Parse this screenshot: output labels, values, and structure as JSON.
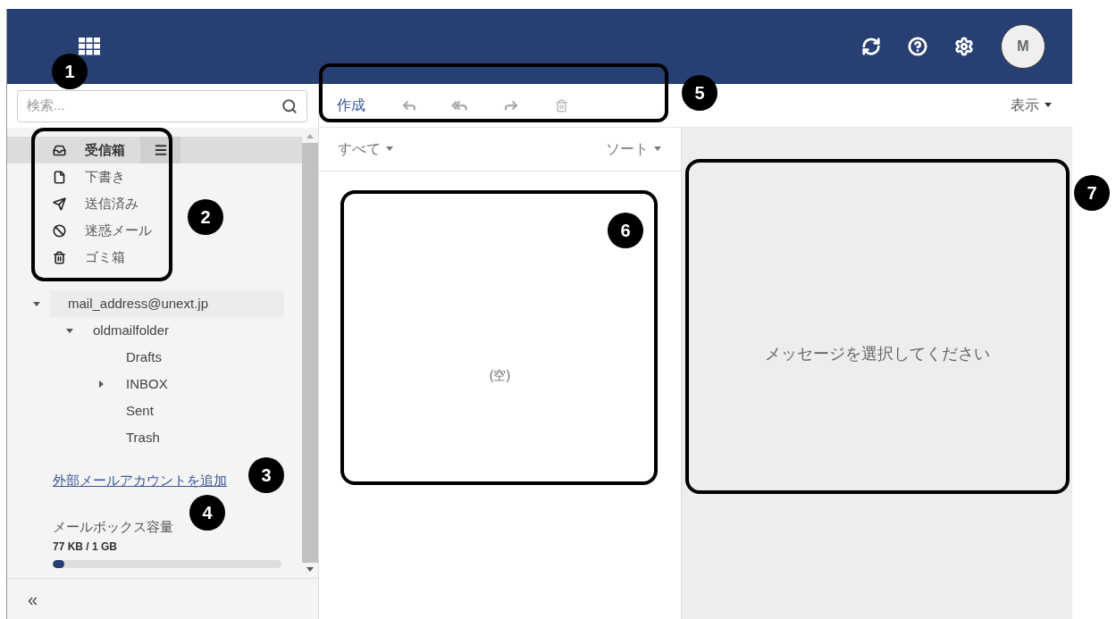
{
  "header": {
    "avatar_initial": "M"
  },
  "search": {
    "placeholder": "検索..."
  },
  "folders": [
    {
      "label": "受信箱",
      "kind": "inbox",
      "selected": true
    },
    {
      "label": "下書き",
      "kind": "draft",
      "selected": false
    },
    {
      "label": "送信済み",
      "kind": "sent",
      "selected": false
    },
    {
      "label": "迷惑メール",
      "kind": "spam",
      "selected": false
    },
    {
      "label": "ゴミ箱",
      "kind": "trash",
      "selected": false
    }
  ],
  "tree": [
    {
      "label": "mail_address@unext.jp",
      "expanded": true,
      "children": [
        {
          "label": "oldmailfolder",
          "expanded": true,
          "children": [
            {
              "label": "Drafts"
            },
            {
              "label": "INBOX",
              "expanded": false
            },
            {
              "label": "Sent"
            },
            {
              "label": "Trash"
            }
          ]
        }
      ]
    }
  ],
  "add_account_link": "外部メールアカウントを追加",
  "quota": {
    "label": "メールボックス容量",
    "reading": "77 KB / 1 GB",
    "level": 0.05
  },
  "collapse_button": "«",
  "toolbar": {
    "compose": "作成",
    "view_menu": "表示"
  },
  "list": {
    "filter": "すべて",
    "sort": "ソート",
    "empty": "(空)"
  },
  "preview": {
    "message": "メッセージを選択してください"
  },
  "annotations": [
    {
      "number": "1"
    },
    {
      "number": "2"
    },
    {
      "number": "3"
    },
    {
      "number": "4"
    },
    {
      "number": "5"
    },
    {
      "number": "6"
    },
    {
      "number": "7"
    }
  ]
}
